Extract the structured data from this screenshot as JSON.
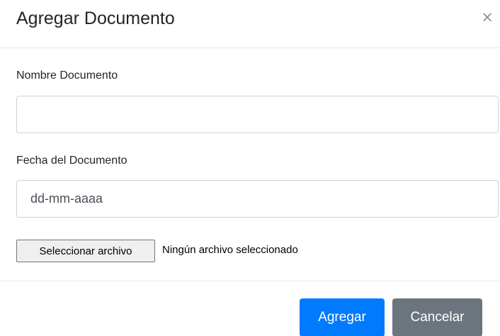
{
  "modal": {
    "title": "Agregar Documento",
    "close_glyph": "×",
    "close_icon": "close-icon"
  },
  "form": {
    "name_label": "Nombre Documento",
    "name_value": "",
    "date_label": "Fecha del Documento",
    "date_placeholder": "dd-mm-aaaa",
    "file_button_label": "Seleccionar archivo",
    "file_status": "Ningún archivo seleccionado"
  },
  "footer": {
    "submit_label": "Agregar",
    "cancel_label": "Cancelar"
  },
  "colors": {
    "primary": "#007bff",
    "secondary": "#6c757d",
    "divider": "#e6e8ea",
    "input_border": "#ced4da"
  }
}
